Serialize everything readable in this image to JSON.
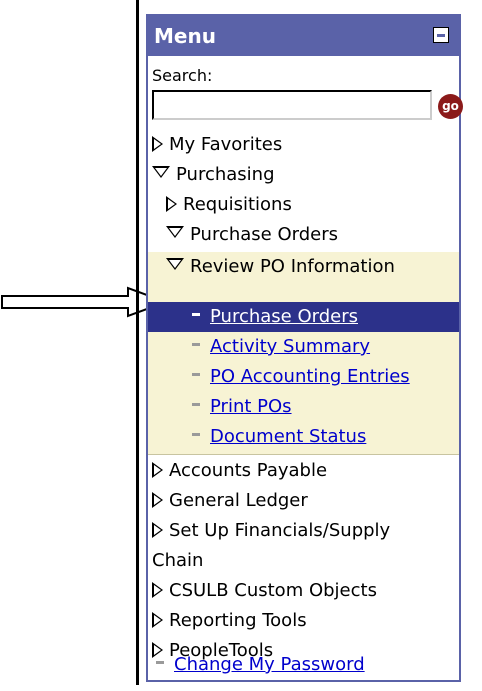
{
  "menu": {
    "title": "Menu",
    "search_label": "Search:",
    "search_value": "",
    "go_label": "go"
  },
  "tree": {
    "my_favorites": "My Favorites",
    "purchasing": "Purchasing",
    "requisitions": "Requisitions",
    "purchase_orders": "Purchase Orders",
    "review_po_info": "Review PO Information",
    "po_links": [
      "Purchase Orders",
      "Activity Summary",
      "PO Accounting Entries",
      "Print POs",
      "Document Status"
    ],
    "accounts_payable": "Accounts Payable",
    "general_ledger": "General Ledger",
    "setup_financials_line1": "Set Up Financials/Supply",
    "setup_financials_line2": "Chain",
    "csulb_custom": "CSULB Custom Objects",
    "reporting_tools": "Reporting Tools",
    "peopletools": "PeopleTools",
    "change_password": "Change My Password"
  },
  "colors": {
    "header_bg": "#5a62a8",
    "selected_bg": "#2c318a",
    "section_bg": "#f7f3d4",
    "link": "#0000cc"
  }
}
